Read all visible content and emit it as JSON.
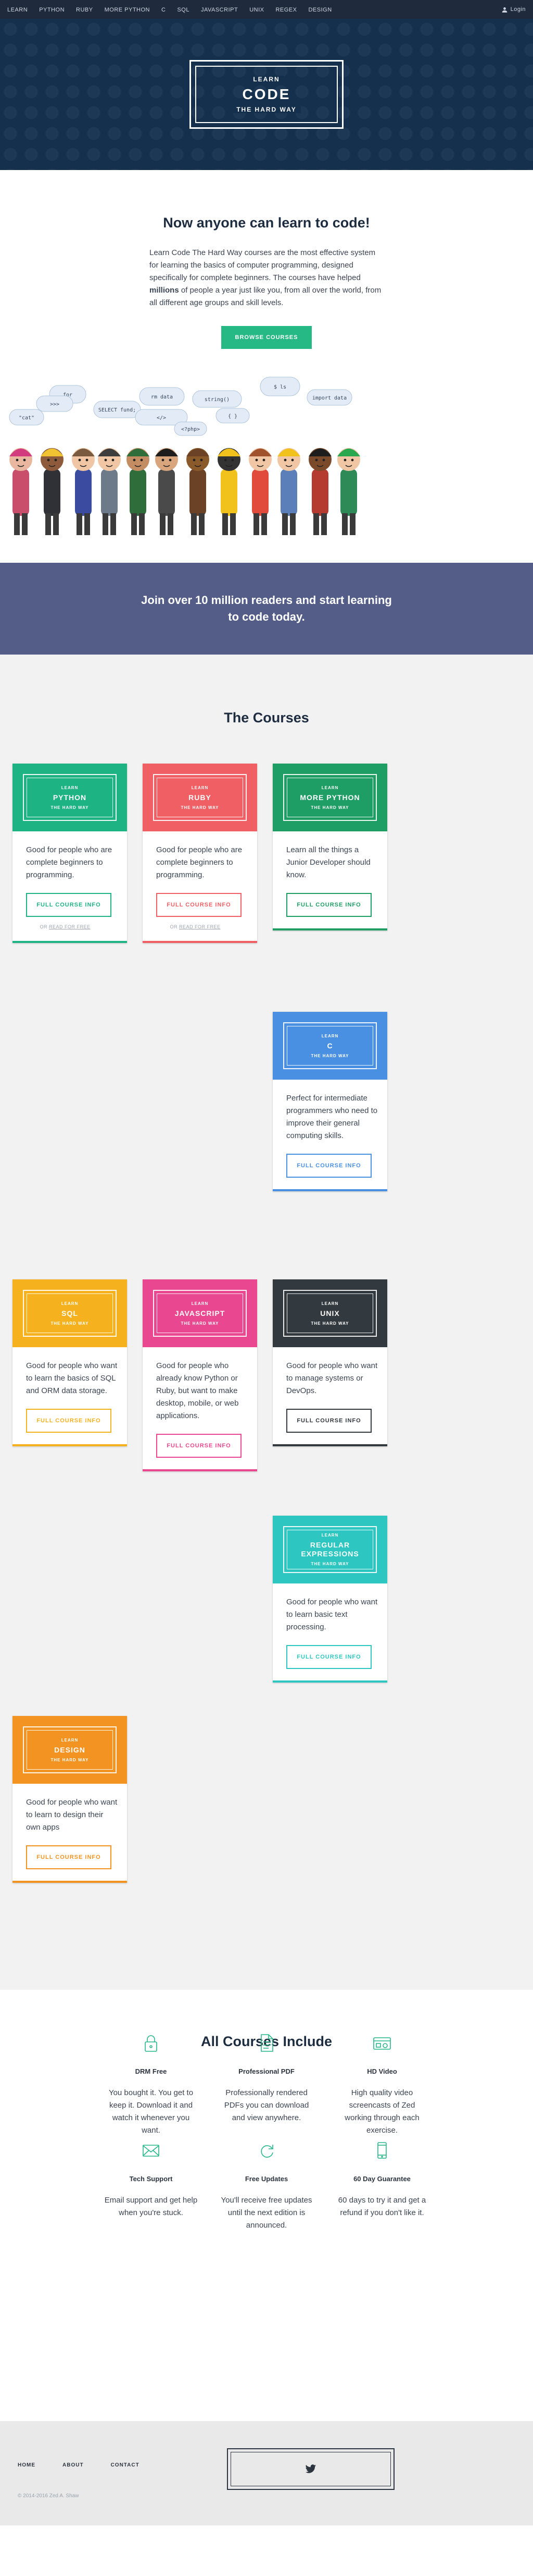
{
  "nav": {
    "items": [
      "Learn",
      "Python",
      "Ruby",
      "More Python",
      "C",
      "SQL",
      "JavaScript",
      "Unix",
      "Regex",
      "Design"
    ],
    "login": "Login"
  },
  "hero": {
    "logo_line1": "LEARN",
    "logo_line2": "CODE",
    "logo_line3": "THE HARD WAY"
  },
  "intro": {
    "title": "Now anyone can learn to code!",
    "text_before": "Learn Code The Hard Way courses are the most effective system for learning the basics of computer programming, designed specifically for complete beginners. The courses have helped ",
    "text_bold": "millions",
    "text_after": " of people a year just like you, from all over the world, from all different age groups and skill levels.",
    "button": "Browse Courses"
  },
  "illustration": {
    "bubbles": [
      "for",
      "SELECT fund;",
      "rm data",
      "string()",
      "</>",
      "$ ls",
      "{ }",
      "import data",
      ">>>",
      "<?php>",
      "\"cat\""
    ]
  },
  "join": {
    "text": "Join over 10 million readers and start learning to code today."
  },
  "courses": {
    "title": "The Courses",
    "badge_top": "LEARN",
    "badge_bottom": "THE HARD WAY",
    "button": "Full Course Info",
    "free_prefix": "OR",
    "free_link": "READ FOR FREE",
    "items": [
      {
        "name": "Python",
        "desc": "Good for people who are complete beginners to programming.",
        "color": "#1eb382",
        "free": true
      },
      {
        "name": "Ruby",
        "desc": "Good for people who are complete beginners to programming.",
        "color": "#ef5f64",
        "free": true
      },
      {
        "name": "More Python",
        "desc": "Learn all the things a Junior Developer should know.",
        "color": "#1e9e64",
        "free": false
      },
      {
        "name": "C",
        "desc": "Perfect for intermediate programmers who need to improve their general computing skills.",
        "color": "#4a90e2",
        "free": false
      },
      {
        "name": "SQL",
        "desc": "Good for people who want to learn the basics of SQL and ORM data storage.",
        "color": "#f5b21e",
        "free": false
      },
      {
        "name": "JavaScript",
        "desc": "Good for people who already know Python or Ruby, but want to make desktop, mobile, or web applications.",
        "color": "#e9478f",
        "free": false
      },
      {
        "name": "Unix",
        "desc": "Good for people who want to manage systems or DevOps.",
        "color": "#333a3f",
        "free": false
      },
      {
        "name": "Regular Expressions",
        "desc": "Good for people who want to learn basic text processing.",
        "color": "#2ec6c0",
        "free": false
      },
      {
        "name": "Design",
        "desc": "Good for people who want to learn to design their own apps",
        "color": "#f39422",
        "free": false
      }
    ]
  },
  "include": {
    "title": "All Courses Include",
    "icon_color": "#26b885",
    "features": [
      {
        "title": "DRM Free",
        "icon": "lock-icon",
        "text": "You bought it. You get to keep it. Download it and watch it whenever you want."
      },
      {
        "title": "Professional PDF",
        "icon": "document-icon",
        "text": "Professionally rendered PDFs you can download and view anywhere."
      },
      {
        "title": "HD Video",
        "icon": "video-icon",
        "text": "High quality video screencasts of Zed working through each exercise."
      },
      {
        "title": "Tech Support",
        "icon": "envelope-icon",
        "text": "Email support and get help when you're stuck."
      },
      {
        "title": "Free Updates",
        "icon": "refresh-icon",
        "text": "You'll receive free updates until the next edition is announced."
      },
      {
        "title": "60 Day Guarantee",
        "icon": "phone-icon",
        "text": "60 days to try it and get a refund if you don't like it."
      }
    ]
  },
  "footer": {
    "links": [
      "Home",
      "About",
      "Contact"
    ],
    "copyright": "© 2014-2016 Zed A. Shaw",
    "twitter_icon": "twitter-icon"
  }
}
